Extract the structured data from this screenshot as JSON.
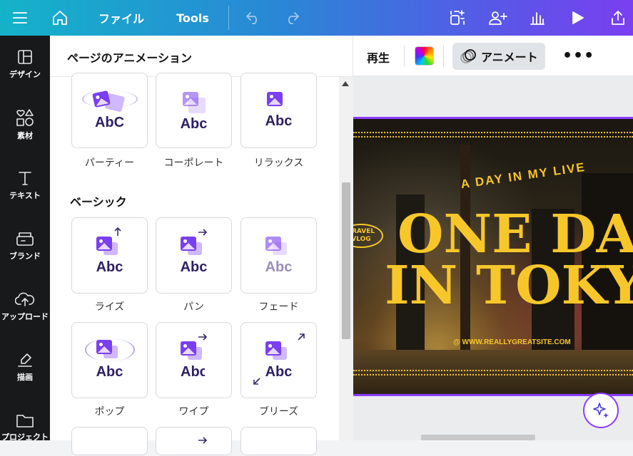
{
  "topbar": {
    "menu_icon": "hamburger-icon",
    "home_icon": "home-icon",
    "file_label": "ファイル",
    "tools_label": "Tools",
    "undo_icon": "undo-icon",
    "redo_icon": "redo-icon",
    "right_icons": [
      "magic-resize-icon",
      "add-people-icon",
      "chart-icon",
      "play-icon",
      "share-upload-icon"
    ]
  },
  "sidebar": {
    "items": [
      {
        "label": "デザイン",
        "icon": "layout-icon"
      },
      {
        "label": "素材",
        "icon": "elements-icon"
      },
      {
        "label": "テキスト",
        "icon": "text-icon"
      },
      {
        "label": "ブランド",
        "icon": "brand-icon"
      },
      {
        "label": "アップロード",
        "icon": "upload-icon"
      },
      {
        "label": "描画",
        "icon": "draw-icon"
      },
      {
        "label": "プロジェクト",
        "icon": "folder-icon"
      }
    ]
  },
  "panel": {
    "title": "ページのアニメーション",
    "top_row": [
      {
        "label": "パーティー",
        "preview": "AbC"
      },
      {
        "label": "コーポレート",
        "preview": "Abc"
      },
      {
        "label": "リラックス",
        "preview": "Abc"
      }
    ],
    "section_basic": "ベーシック",
    "basic": [
      {
        "label": "ライズ",
        "preview": "Abc"
      },
      {
        "label": "パン",
        "preview": "Abc"
      },
      {
        "label": "フェード",
        "preview": "Abc"
      },
      {
        "label": "ポップ",
        "preview": "Abc"
      },
      {
        "label": "ワイプ",
        "preview": "Abc"
      },
      {
        "label": "ブリーズ",
        "preview": "Abc"
      }
    ]
  },
  "context_toolbar": {
    "play_label": "再生",
    "animate_label": "アニメート",
    "animate_icon": "animate-circles-icon",
    "more_icon": "more-dots-icon",
    "more_label": "•••"
  },
  "canvas": {
    "arc_text": "A DAY IN MY LIVE",
    "headline_1": "ONE DAY",
    "headline_2": "IN TOKYO",
    "badge_text_1": "TRAVEL",
    "badge_text_2": "VLOG",
    "website": "@ WWW.REALLYGREATSITE.COM",
    "accent_color": "#f7c72a",
    "selection_color": "#8b3dff"
  },
  "magic_button_icon": "sparkle-icon"
}
